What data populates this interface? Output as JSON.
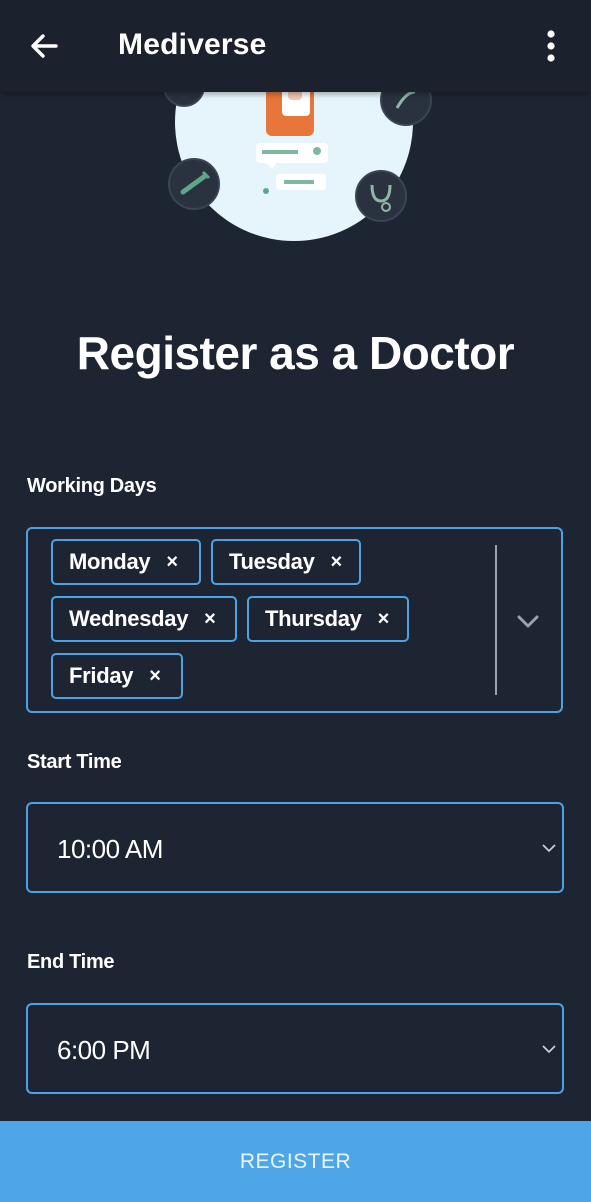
{
  "appbar": {
    "title": "Mediverse",
    "back_icon": "arrow-left-icon",
    "menu_icon": "more-vertical-icon"
  },
  "hero": {
    "illustration": "doctor-illustration"
  },
  "heading": "Register as a Doctor",
  "working_days": {
    "label": "Working Days",
    "selected": [
      "Monday",
      "Tuesday",
      "Wednesday",
      "Thursday",
      "Friday"
    ],
    "remove_symbol": "×"
  },
  "start_time": {
    "label": "Start Time",
    "value": "10:00 AM"
  },
  "end_time": {
    "label": "End Time",
    "value": "6:00 PM"
  },
  "register_button": {
    "label": "REGISTER"
  },
  "colors": {
    "background": "#1e2532",
    "appbar": "#1c222d",
    "accent": "#4aa3e6",
    "button": "#4da6e8"
  }
}
